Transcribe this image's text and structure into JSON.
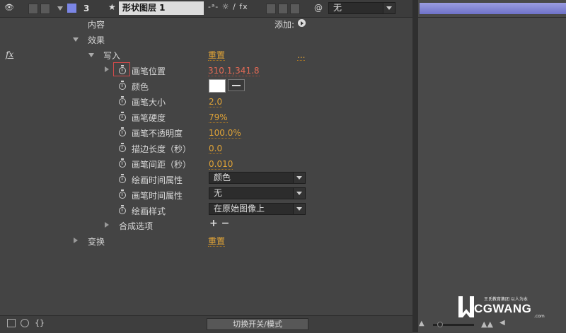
{
  "layer": {
    "number": "3",
    "name": "形状图层 1",
    "color": "#7b86e6",
    "switches": "-ᵃ- ☼ / fx",
    "parent_value": "无"
  },
  "tree": {
    "contents_label": "内容",
    "add_label": "添加:",
    "effects_label": "效果",
    "fx_label": "fx",
    "write_on": {
      "label": "写入",
      "reset": "重置",
      "options": "..."
    },
    "props": {
      "brush_position": {
        "label": "画笔位置",
        "value": "310.1,341.8"
      },
      "color": {
        "label": "颜色",
        "swatch": "#ffffff"
      },
      "brush_size": {
        "label": "画笔大小",
        "value": "2.0"
      },
      "brush_hardness": {
        "label": "画笔硬度",
        "value": "79%"
      },
      "brush_opacity": {
        "label": "画笔不透明度",
        "value": "100.0%"
      },
      "stroke_length": {
        "label": "描边长度（秒）",
        "value": "0.0"
      },
      "brush_spacing": {
        "label": "画笔间距（秒）",
        "value": "0.010"
      },
      "paint_time_props": {
        "label": "绘画时间属性",
        "value": "颜色"
      },
      "brush_time_props": {
        "label": "画笔时间属性",
        "value": "无"
      },
      "paint_style": {
        "label": "绘画样式",
        "value": "在原始图像上"
      }
    },
    "compositing": {
      "label": "合成选项",
      "controls": "+ −"
    },
    "transform": {
      "label": "变换",
      "reset": "重置"
    }
  },
  "bottom": {
    "toggle_label": "切换开关/模式"
  },
  "watermark": {
    "brand": "CGWANG",
    "tagline": "王氏教育集团 以人为本",
    "domain": ".com"
  },
  "colors": {
    "value_orange": "#e1a437",
    "value_red": "#e36a55",
    "timeline_bar": "#8486d6"
  }
}
